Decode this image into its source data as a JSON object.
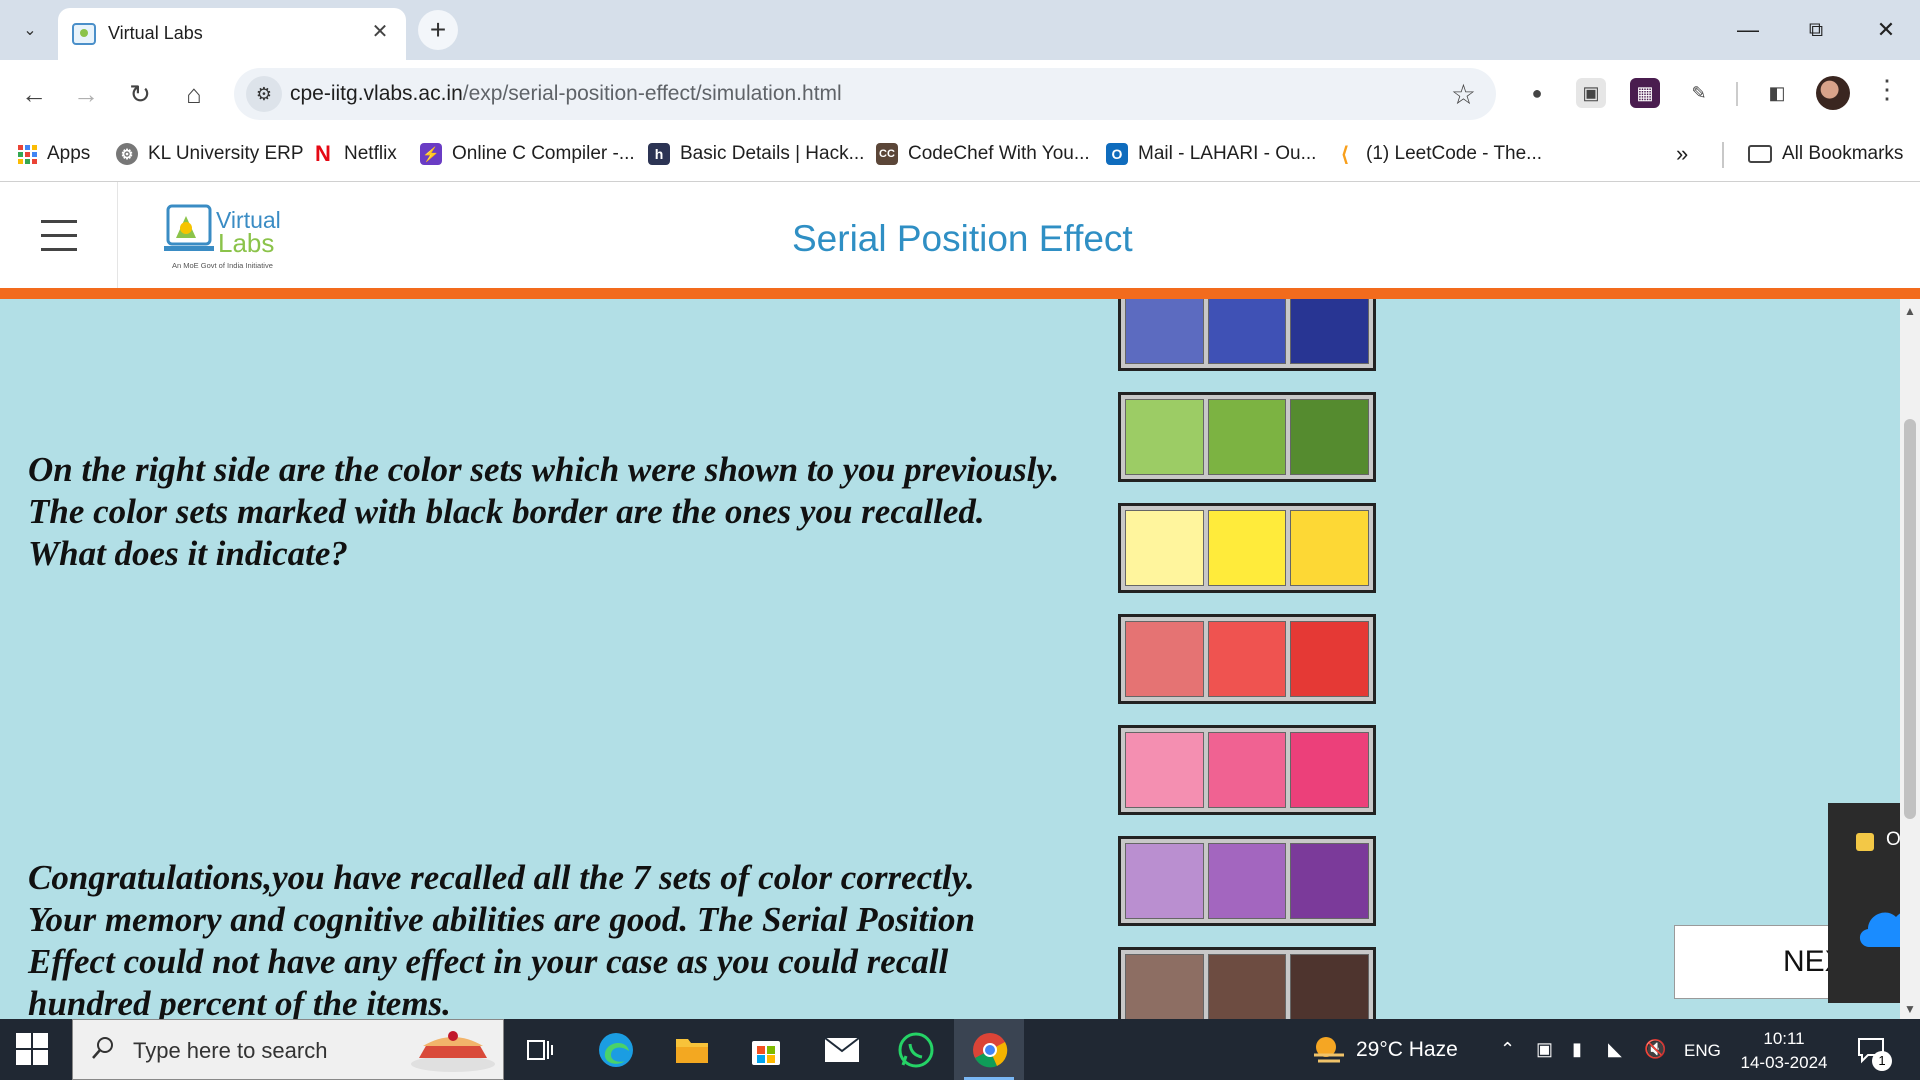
{
  "browser": {
    "tab_title": "Virtual Labs",
    "url_host": "cpe-iitg.vlabs.ac.in",
    "url_path": "/exp/serial-position-effect/simulation.html",
    "bookmarks": [
      {
        "label": "Apps",
        "icon": "apps-grid-icon"
      },
      {
        "label": "KL University ERP",
        "icon": "gear-icon"
      },
      {
        "label": "Netflix",
        "icon": "netflix-icon"
      },
      {
        "label": "Online C Compiler -...",
        "icon": "bolt-icon"
      },
      {
        "label": "Basic Details  | Hack...",
        "icon": "hackerearth-icon"
      },
      {
        "label": "CodeChef With You...",
        "icon": "codechef-icon"
      },
      {
        "label": "Mail - LAHARI - Ou...",
        "icon": "outlook-icon"
      },
      {
        "label": "(1) LeetCode - The...",
        "icon": "leetcode-icon"
      }
    ],
    "all_bookmarks_label": "All Bookmarks"
  },
  "page": {
    "title": "Serial Position Effect",
    "logo_text_1": "Virtual",
    "logo_text_2": "Labs",
    "logo_tagline": "An MoE Govt of India Initiative",
    "question": "On the right side are the color sets which were shown to you previously. The color sets marked with black border are the ones you recalled. What does it indicate?",
    "result": "Congratulations,you have recalled all the 7 sets of color correctly. Your memory and cognitive abilities are good. The Serial Position Effect could not have any effect in your case as you could recall hundred percent of the items.",
    "next_label": "NEXT",
    "color_sets": [
      {
        "name": "indigo",
        "colors": [
          "#5c6bc0",
          "#3f51b5",
          "#283593"
        ]
      },
      {
        "name": "green",
        "colors": [
          "#9ccc65",
          "#7cb342",
          "#558b2f"
        ]
      },
      {
        "name": "yellow",
        "colors": [
          "#fff59d",
          "#ffeb3b",
          "#fdd835"
        ]
      },
      {
        "name": "red",
        "colors": [
          "#e57373",
          "#ef5350",
          "#e53935"
        ]
      },
      {
        "name": "pink",
        "colors": [
          "#f48fb1",
          "#f06292",
          "#ec407a"
        ]
      },
      {
        "name": "purple",
        "colors": [
          "#ba8fd0",
          "#a366bf",
          "#7b3a9a"
        ]
      },
      {
        "name": "brown",
        "colors": [
          "#8d6e63",
          "#6d4c41",
          "#4e342e"
        ]
      }
    ]
  },
  "onedrive": {
    "label": "One"
  },
  "taskbar": {
    "search_placeholder": "Type here to search",
    "weather": "29°C  Haze",
    "lang": "ENG",
    "time": "10:11",
    "date": "14-03-2024",
    "notification_count": "1"
  }
}
